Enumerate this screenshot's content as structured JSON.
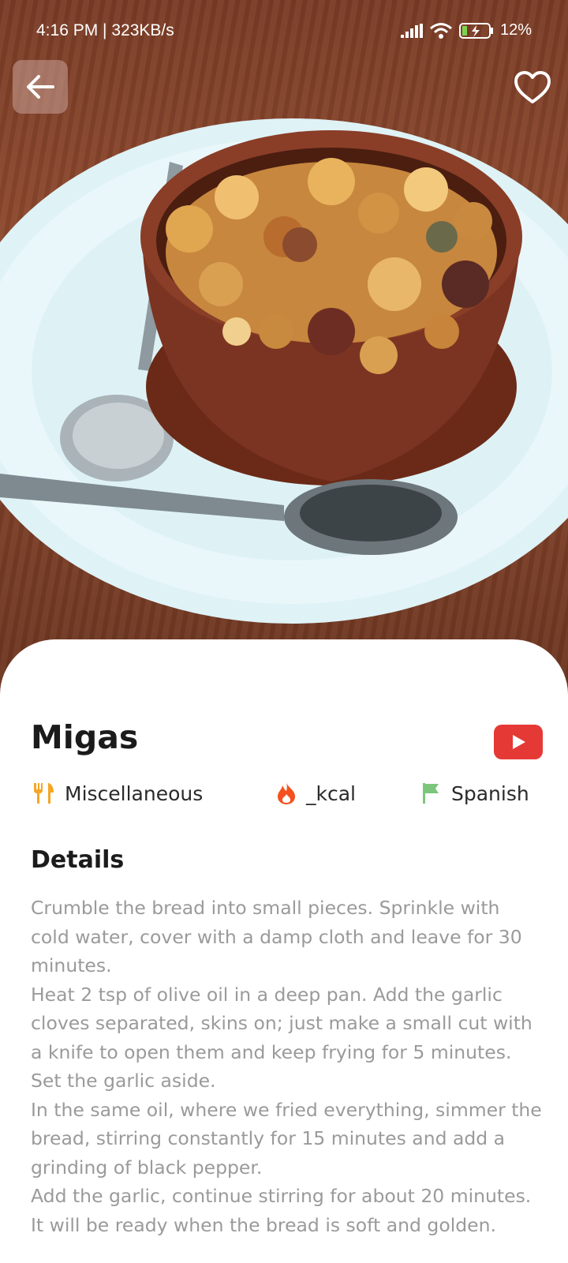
{
  "status_bar": {
    "time": "4:16 PM | 323KB/s",
    "battery_pct": "12%"
  },
  "icons": {
    "back": "arrow-left-icon",
    "favorite": "heart-outline-icon",
    "youtube": "youtube-play-icon",
    "category": "fork-knife-icon",
    "calories": "fire-icon",
    "area": "flag-icon"
  },
  "colors": {
    "youtube_red": "#e53935",
    "category_icon": "#f5a623",
    "calories_icon": "#f4511e",
    "area_icon": "#7cc67c"
  },
  "meal": {
    "title": "Migas",
    "category": "Miscellaneous",
    "calories": "_kcal",
    "area": "Spanish"
  },
  "details": {
    "heading": "Details",
    "paragraphs": [
      "Crumble the bread into small pieces. Sprinkle with cold water, cover with a damp cloth and leave for 30 minutes.",
      "Heat 2 tsp of olive oil in a deep pan. Add the garlic cloves separated, skins on; just make a small cut with a knife to open them and keep frying for 5 minutes. Set the garlic aside.",
      "In the same oil, where we fried everything, simmer the bread, stirring constantly for 15 minutes and add a grinding of black pepper.",
      "Add the garlic, continue stirring for about 20 minutes. It will be ready when the bread is soft and golden."
    ]
  }
}
